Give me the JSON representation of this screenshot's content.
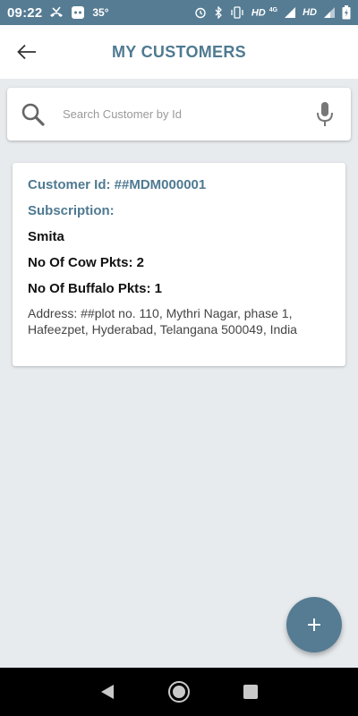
{
  "status_bar": {
    "time": "09:22",
    "temperature": "35°",
    "network_1": "HD",
    "network_1_type": "4G",
    "network_2": "HD"
  },
  "header": {
    "title": "MY CUSTOMERS",
    "back_icon": "arrow-left-icon"
  },
  "search": {
    "placeholder": "Search Customer by Id",
    "value": "",
    "search_icon": "search-icon",
    "mic_icon": "microphone-icon"
  },
  "customers": [
    {
      "customer_id": "Customer Id: ##MDM000001",
      "subscription_label": "Subscription:",
      "name": "Smita",
      "cow_pkts": "No Of Cow Pkts: 2",
      "buffalo_pkts": "No Of Buffalo Pkts: 1",
      "address": "Address: ##plot no. 110, Mythri Nagar, phase 1, Hafeezpet, Hyderabad, Telangana 500049, India"
    }
  ],
  "fab": {
    "icon": "plus-icon"
  },
  "nav": {
    "back_icon": "triangle-back-icon",
    "home_icon": "circle-home-icon",
    "recents_icon": "square-recents-icon"
  },
  "colors": {
    "primary": "#557c93",
    "title": "#4f7a91",
    "background": "#e7ebee"
  }
}
